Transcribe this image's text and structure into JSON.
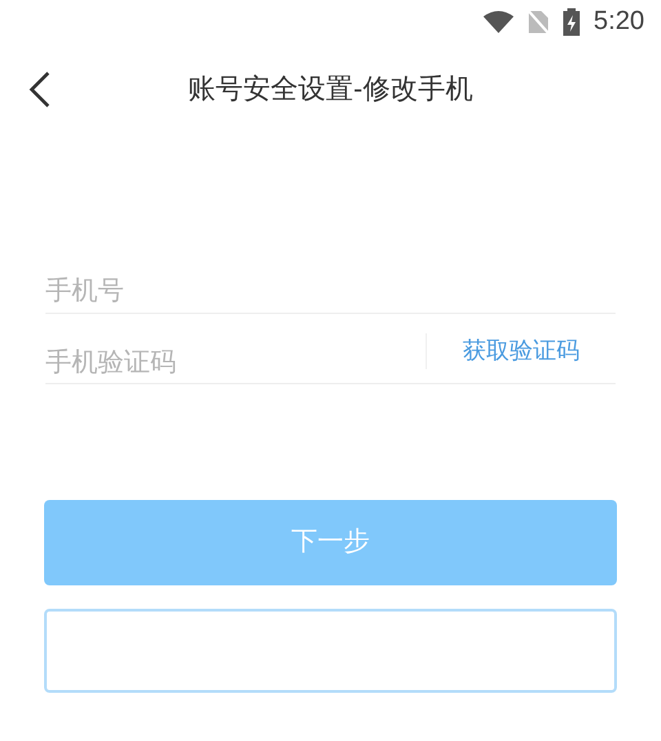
{
  "status_bar": {
    "time": "5:20"
  },
  "header": {
    "title": "账号安全设置-修改手机"
  },
  "fields": [
    {
      "placeholder": "手机号"
    },
    {
      "placeholder": "手机验证码",
      "action": "获取验证码"
    }
  ],
  "buttons": [
    {
      "kind": "primary",
      "label": "下一步"
    },
    {
      "kind": "outline"
    }
  ]
}
